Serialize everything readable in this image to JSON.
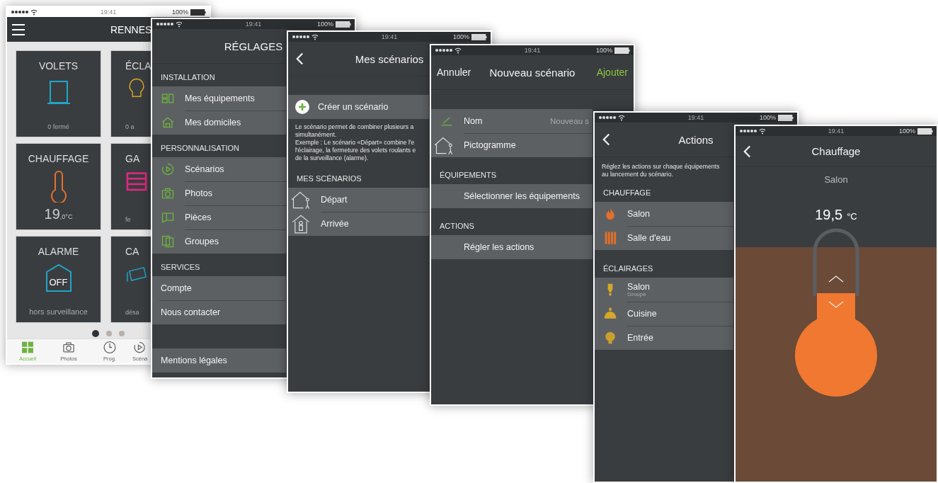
{
  "screens": [
    {
      "kind": "home",
      "status": {
        "time": "19:41",
        "battery": "100%"
      },
      "title": "RENNES",
      "tiles": [
        {
          "kind": "shutter",
          "label": "VOLETS",
          "status": "0 fermé",
          "color": "#1fa6c9"
        },
        {
          "kind": "bulb",
          "label": "ÉCLA",
          "status": "0 a",
          "color": "#d8a523"
        },
        {
          "kind": "thermometer",
          "label": "CHAUFFAGE",
          "value": "19",
          "unit": ",0°C",
          "color": "#e5722b"
        },
        {
          "kind": "garage",
          "label": "GA",
          "status": "fe",
          "color": "#e0287f"
        },
        {
          "kind": "alarm",
          "label": "ALARME",
          "badge": "OFF",
          "status": "hors surveillance",
          "color": "#1fa6c9"
        },
        {
          "kind": "camera",
          "label": "CA",
          "status": "désa",
          "color": "#1fa6c9"
        }
      ],
      "pages": [
        {
          "selected": true
        },
        {
          "selected": false
        },
        {
          "selected": false
        }
      ],
      "tabs": [
        {
          "kind": "grid",
          "label": "Accueil",
          "selected": true
        },
        {
          "kind": "camera",
          "label": "Photos",
          "selected": false
        },
        {
          "kind": "clock",
          "label": "Prog.",
          "selected": false
        },
        {
          "kind": "play",
          "label": "Scéna",
          "selected": false
        }
      ]
    },
    {
      "kind": "settings",
      "status": {
        "time": "19:41",
        "battery": "100%"
      },
      "title": "RÉGLAGES",
      "sections": [
        {
          "title": "INSTALLATION",
          "items": [
            {
              "kind": "devices",
              "label": "Mes équipements"
            },
            {
              "kind": "house",
              "label": "Mes domiciles"
            }
          ]
        },
        {
          "title": "PERSONNALISATION",
          "items": [
            {
              "kind": "play",
              "label": "Scénarios"
            },
            {
              "kind": "camera",
              "label": "Photos"
            },
            {
              "kind": "rooms",
              "label": "Pièces"
            },
            {
              "kind": "groups",
              "label": "Groupes"
            }
          ]
        },
        {
          "title": "SERVICES",
          "items": [
            {
              "kind": "plain",
              "label": "Compte"
            },
            {
              "kind": "plain",
              "label": "Nous contacter"
            }
          ]
        },
        {
          "items": [
            {
              "kind": "plain",
              "label": "Mentions légales"
            }
          ]
        }
      ]
    },
    {
      "kind": "scenarios",
      "status": {
        "time": "19:41",
        "battery": "100%"
      },
      "title": "Mes scénarios",
      "create": "Créer un scénario",
      "description": "Le scénario permet de combiner plusieurs a\nsimultanément.\nExemple : Le scénario «Départ» combine l'e\nl'éclairage, la fermeture des volets roulants e\nde la surveillance (alarme).",
      "section": "MES SCÉNARIOS",
      "items": [
        {
          "kind": "leaving",
          "label": "Départ"
        },
        {
          "kind": "arriving",
          "label": "Arrivée"
        }
      ]
    },
    {
      "kind": "new_scenario",
      "status": {
        "time": "19:41",
        "battery": "100%"
      },
      "cancel": "Annuler",
      "title": "Nouveau scénario",
      "add": "Ajouter",
      "name": {
        "label": "Nom",
        "value": "Nouveau s"
      },
      "pictogram": "Pictogramme",
      "sections": [
        {
          "title": "ÉQUIPEMENTS",
          "action": "Sélectionner les équipements"
        },
        {
          "title": "ACTIONS",
          "action": "Régler les actions"
        }
      ]
    },
    {
      "kind": "actions",
      "status": {
        "time": "19:41",
        "battery": "100%"
      },
      "title": "Actions",
      "description": "Réglez les actions sur chaque équipements\nau lancement du scénario.",
      "sections": [
        {
          "title": "CHAUFFAGE",
          "items": [
            {
              "kind": "flame",
              "label": "Salon"
            },
            {
              "kind": "radiator",
              "label": "Salle d'eau"
            }
          ]
        },
        {
          "title": "ÉCLAIRAGES",
          "items": [
            {
              "kind": "bulb",
              "label": "Salon",
              "sublabel": "Groupe"
            },
            {
              "kind": "pendant",
              "label": "Cuisine"
            },
            {
              "kind": "globe",
              "label": "Entrée"
            }
          ]
        }
      ]
    },
    {
      "kind": "thermostat",
      "status": {
        "time": "19:41",
        "battery": "100%"
      },
      "title": "Chauffage",
      "room": "Salon",
      "temperature": "19,5",
      "unit": "°C"
    }
  ]
}
